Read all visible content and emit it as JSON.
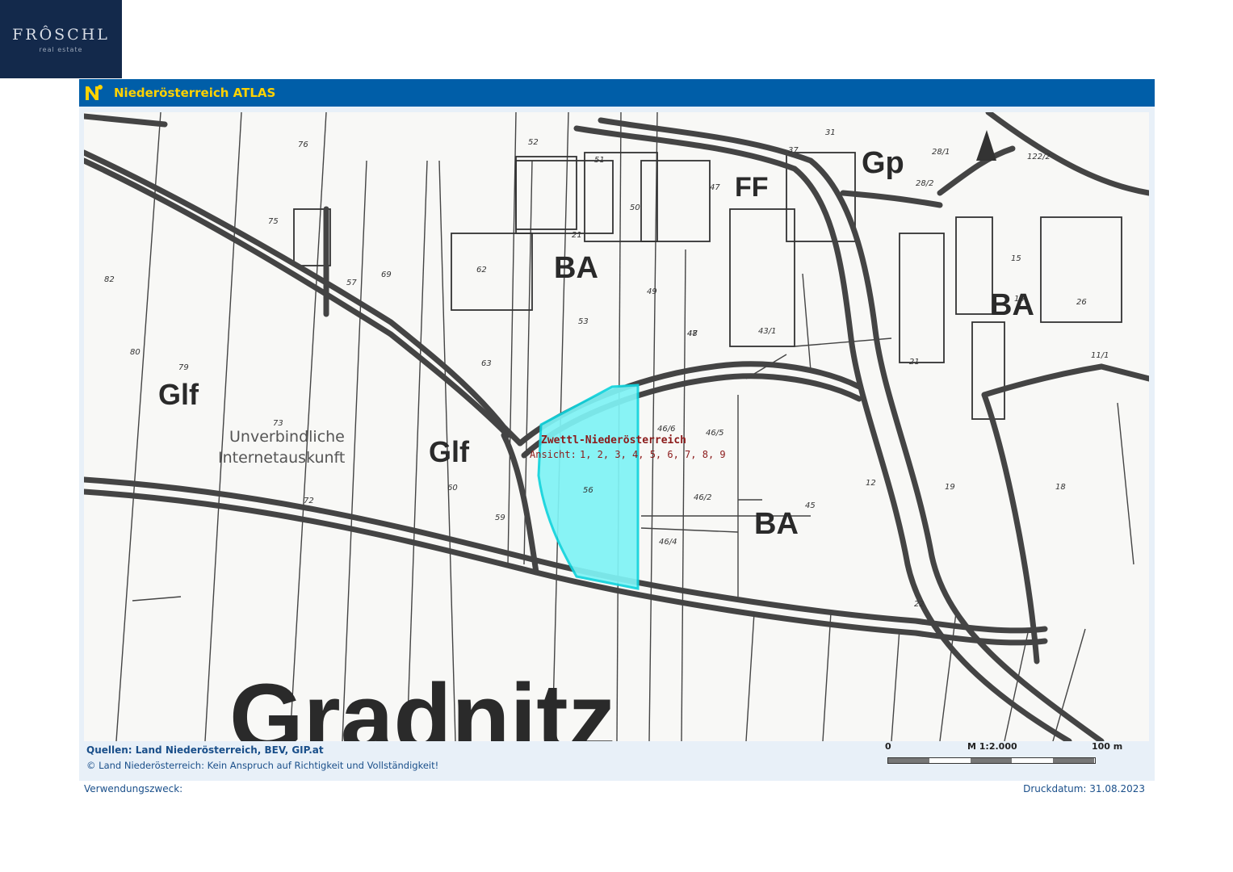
{
  "brand": {
    "name": "FRÔSCHL",
    "sub": "real estate",
    "bg": "#13294b"
  },
  "atlas": {
    "title": "Niederösterreich ATLAS",
    "title_color": "#ffd200",
    "bar_color": "#005ea8",
    "logo_icon": "noe-logo-icon"
  },
  "map": {
    "zones": [
      "Glf",
      "Glf",
      "BA",
      "BA",
      "BA",
      "FF",
      "Gp"
    ],
    "village": "Gradnitz",
    "watermark": [
      "Unverbindliche",
      "Internetauskunft"
    ],
    "highlight": {
      "parcel": "56",
      "color": "#7ff3f5"
    },
    "popup": {
      "title": "Zwettl-Niederösterreich",
      "views_label": "Ansicht: ",
      "views": "1, 2, 3, 4, 5, 6, 7, 8, 9"
    },
    "parcels": [
      "76",
      "75",
      "52",
      "51",
      "50",
      "49",
      "48",
      "47",
      "57",
      "69",
      "62",
      "53",
      "63",
      "21",
      "47",
      "31",
      "37",
      "28/1",
      "28/2",
      "15",
      "26",
      "80",
      "79",
      "73",
      "72",
      "82",
      "60",
      "59",
      "45",
      "46/6",
      "46/5",
      "46/2",
      "46/4",
      "56",
      "19",
      "18",
      "12",
      "15",
      "21",
      "22",
      "11/1",
      "122/2",
      "43/1"
    ]
  },
  "footer": {
    "sources": "Quellen: Land Niederösterreich, BEV, GIP.at",
    "disclaimer": "© Land Niederösterreich: Kein Anspruch auf Richtigkeit und Vollständigkeit!",
    "scale_start": "0",
    "scale_ratio": "M 1:2.000",
    "scale_end": "100 m",
    "purpose": "Verwendungszweck:",
    "print_date": "Druckdatum: 31.08.2023"
  }
}
